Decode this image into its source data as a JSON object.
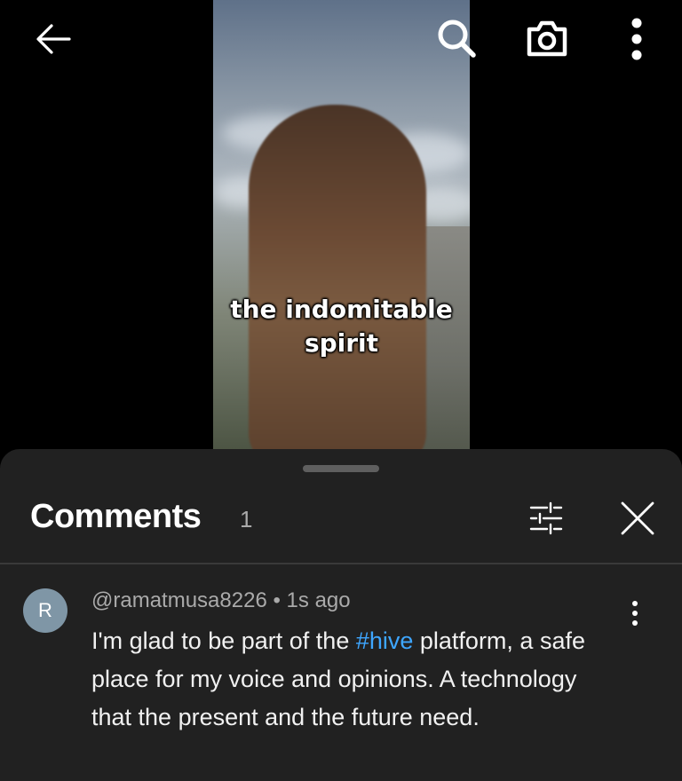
{
  "video": {
    "caption_line1": "the indomitable",
    "caption_line2": "spirit"
  },
  "topbar": {
    "back_icon": "arrow-left-icon",
    "search_icon": "search-icon",
    "camera_icon": "camera-icon",
    "more_icon": "more-vertical-icon"
  },
  "comments": {
    "title": "Comments",
    "count": "1",
    "filter_icon": "sliders-icon",
    "close_icon": "close-icon",
    "items": [
      {
        "avatar_letter": "R",
        "author": "@ramatmusa8226",
        "separator": " • ",
        "time": "1s ago",
        "text_before": "I'm glad to be part of the ",
        "hashtag": "#hive",
        "text_after": " platform, a safe place for my voice and opinions.  A technology that the present and the future need."
      }
    ]
  },
  "colors": {
    "sheet_bg": "#212121",
    "hashtag": "#3ea6ff",
    "muted_text": "#aaaaaa",
    "avatar_bg": "#7f96a6"
  }
}
